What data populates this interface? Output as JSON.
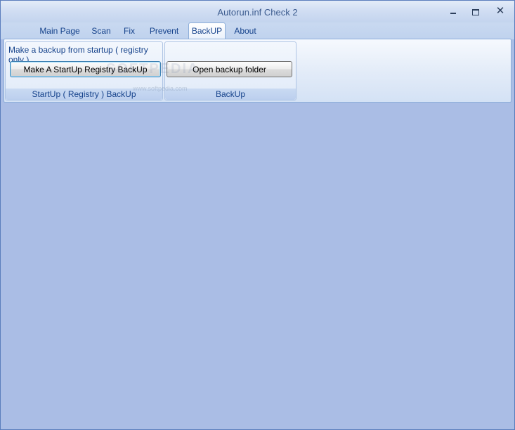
{
  "window": {
    "title": "Autorun.inf Check 2",
    "controls": {
      "minimize": "",
      "maximize": "",
      "close": "✕"
    }
  },
  "tabs": [
    {
      "label": "Main Page"
    },
    {
      "label": "Scan"
    },
    {
      "label": "Fix"
    },
    {
      "label": "Prevent"
    },
    {
      "label": "BackUP"
    },
    {
      "label": "About"
    }
  ],
  "active_tab": "BackUP",
  "ribbon": {
    "startup_group": {
      "description": "Make a backup from startup ( registry only )",
      "button_label": "Make A StartUp Registry BackUp",
      "caption": "StartUp ( Registry ) BackUp"
    },
    "backup_group": {
      "button_label": "Open backup folder",
      "caption": "BackUp"
    }
  },
  "watermark": {
    "text": "SOFTPEDIA",
    "url": "www.softpedia.com"
  },
  "colors": {
    "client_background": "#aabde5",
    "caption_text": "#15428b"
  }
}
